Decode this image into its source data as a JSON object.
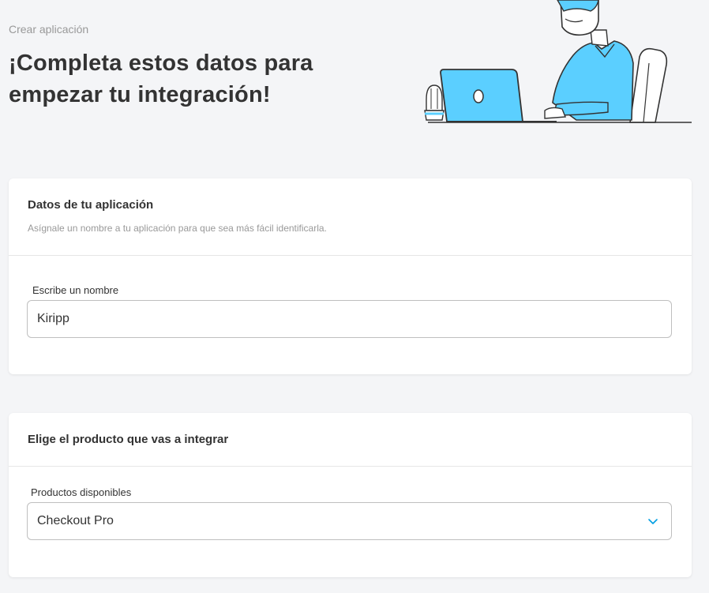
{
  "breadcrumb": "Crear aplicación",
  "page_title": "¡Completa estos datos para empezar tu integración!",
  "app_card": {
    "title": "Datos de tu aplicación",
    "description": "Asígnale un nombre a tu aplicación para que sea más fácil identificarla.",
    "name_label": "Escribe un nombre",
    "name_value": "Kiripp"
  },
  "product_card": {
    "title": "Elige el producto que vas a integrar",
    "products_label": "Productos disponibles",
    "selected_product": "Checkout Pro"
  },
  "colors": {
    "accent": "#009ee3",
    "illustration_blue": "#5bcfff",
    "background": "#f4f5f7"
  },
  "icons": {
    "select_arrow": "chevron-down-icon"
  }
}
